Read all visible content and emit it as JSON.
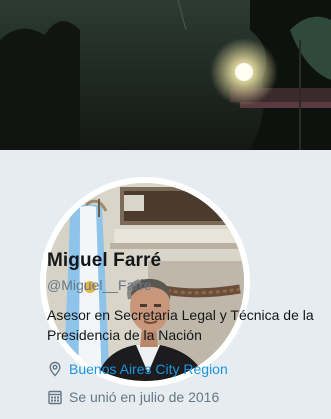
{
  "profile": {
    "name": "Miguel Farré",
    "handle": "@Miguel__Farre",
    "bio": "Asesor en Secretaria Legal y Técnica de la Presidencia de la Nación",
    "location": "Buenos Aires City Region",
    "joined": "Se unió en julio de 2016"
  },
  "icons": {
    "location": "location-pin-icon",
    "joined": "calendar-icon"
  },
  "colors": {
    "background": "#e6ecf0",
    "link": "#1b95e0",
    "secondary_text": "#657786",
    "primary_text": "#14171a"
  }
}
